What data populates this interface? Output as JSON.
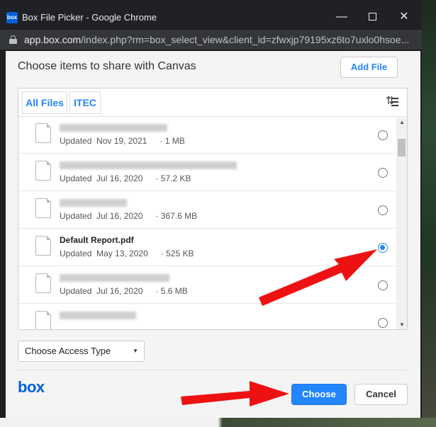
{
  "window": {
    "app_icon": "box",
    "title": "Box File Picker - Google Chrome",
    "controls": [
      "minimize",
      "maximize",
      "close"
    ]
  },
  "urlbar": {
    "host": "app.box.com",
    "path": "/index.php?rm=box_select_view&client_id=zfwxjp79195xz6to7uxlo0hsoe..."
  },
  "dialog": {
    "title": "Choose items to share with Canvas",
    "add_file_label": "Add File",
    "tabs": [
      {
        "label": "All Files"
      },
      {
        "label": "ITEC"
      }
    ],
    "files": [
      {
        "name": "",
        "updated_label": "Updated",
        "date": "Nov 19, 2021",
        "size": "1 MB",
        "selected": false
      },
      {
        "name": "",
        "updated_label": "Updated",
        "date": "Jul 16, 2020",
        "size": "57.2 KB",
        "selected": false
      },
      {
        "name": "",
        "updated_label": "Updated",
        "date": "Jul 16, 2020",
        "size": "367.6 MB",
        "selected": false
      },
      {
        "name": "Default Report.pdf",
        "updated_label": "Updated",
        "date": "May 13, 2020",
        "size": "525 KB",
        "selected": true
      },
      {
        "name": "",
        "updated_label": "Updated",
        "date": "Jul 16, 2020",
        "size": "5.6 MB",
        "selected": false
      },
      {
        "name": "",
        "updated_label": "",
        "date": "",
        "size": "",
        "selected": false
      }
    ],
    "access_type_label": "Choose Access Type",
    "logo": "box",
    "choose_label": "Choose",
    "cancel_label": "Cancel"
  },
  "colors": {
    "accent": "#2486fc",
    "box_brand": "#0061d5",
    "annotation_arrow": "#ee1111"
  }
}
